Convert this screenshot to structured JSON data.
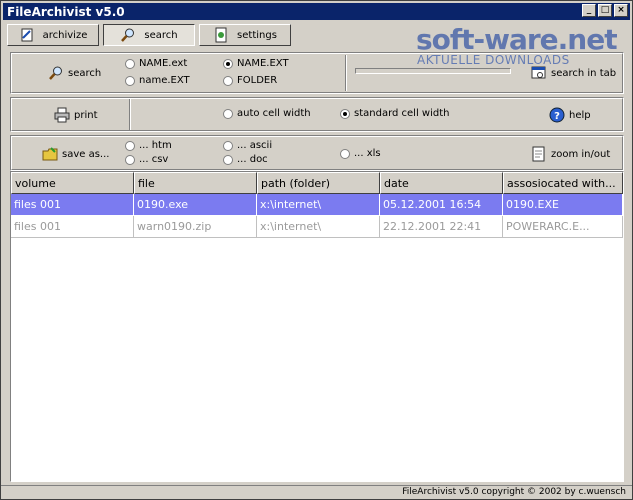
{
  "window": {
    "title": "FileArchivist v5.0"
  },
  "titlebar_buttons": [
    "_",
    "□",
    "×"
  ],
  "tabs": [
    {
      "label": "archivize",
      "icon": "archivize-icon"
    },
    {
      "label": "search",
      "icon": "magnifier-icon",
      "active": true
    },
    {
      "label": "settings",
      "icon": "settings-icon"
    }
  ],
  "watermark": {
    "brand": "soft-ware.net",
    "tagline": "AKTUELLE DOWNLOADS"
  },
  "search_panel": {
    "search_label": "search",
    "options": [
      "NAME.ext",
      "name.EXT",
      "NAME.EXT",
      "FOLDER"
    ],
    "selected": "NAME.EXT",
    "search_in_tab_label": "search in tab"
  },
  "print_panel": {
    "print_label": "print",
    "cell_options": [
      "auto cell width",
      "standard cell width"
    ],
    "selected": "standard cell width",
    "help_label": "help"
  },
  "save_panel": {
    "save_label": "save as...",
    "formats": [
      "... htm",
      "... csv",
      "... ascii",
      "... doc",
      "... xls"
    ],
    "zoom_label": "zoom in/out"
  },
  "table": {
    "columns": [
      "volume",
      "file",
      "path (folder)",
      "date",
      "assosiocated with..."
    ],
    "rows": [
      [
        "files 001",
        "0190.exe",
        "x:\\internet\\",
        "05.12.2001 16:54",
        "0190.EXE"
      ],
      [
        "files 001",
        "warn0190.zip",
        "x:\\internet\\",
        "22.12.2001 22:41",
        "POWERARC.E..."
      ]
    ],
    "selected_row": 0
  },
  "statusbar": {
    "text": "FileArchivist v5.0 copyright © 2002 by c.wuensch"
  },
  "colors": {
    "titlebar": "#0a246a",
    "selection": "#7b7bf0",
    "face": "#d4d0c8"
  }
}
